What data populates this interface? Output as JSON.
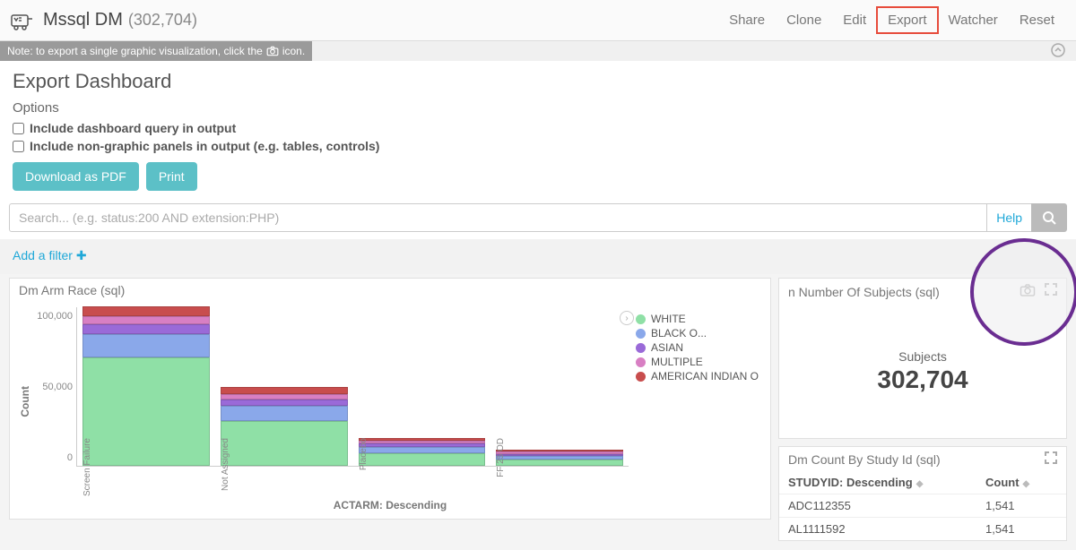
{
  "header": {
    "title": "Mssql DM",
    "count": "(302,704)",
    "nav": [
      "Share",
      "Clone",
      "Edit",
      "Export",
      "Watcher",
      "Reset"
    ],
    "highlighted": "Export"
  },
  "info_note": {
    "prefix": "Note: to export a single graphic visualization, click the",
    "suffix": "icon."
  },
  "export": {
    "title": "Export Dashboard",
    "options_label": "Options",
    "opt1": "Include dashboard query in output",
    "opt2": "Include non-graphic panels in output (e.g. tables, controls)",
    "btn_pdf": "Download as PDF",
    "btn_print": "Print"
  },
  "search": {
    "placeholder": "Search... (e.g. status:200 AND extension:PHP)",
    "help": "Help"
  },
  "filter": {
    "add_label": "Add a filter"
  },
  "panel_chart": {
    "title": "Dm Arm Race (sql)",
    "ylabel": "Count",
    "xlabel": "ACTARM: Descending",
    "yticks": [
      "100,000",
      "50,000",
      "0"
    ]
  },
  "panel_subjects": {
    "title": "n Number Of Subjects (sql)",
    "label": "Subjects",
    "value": "302,704"
  },
  "panel_table": {
    "title": "Dm Count By Study Id (sql)",
    "col1": "STUDYID: Descending",
    "col2": "Count",
    "rows": [
      {
        "study": "ADC112355",
        "count": "1,541"
      },
      {
        "study": "AL1111592",
        "count": "1,541"
      }
    ]
  },
  "chart_data": {
    "type": "bar",
    "stacked": true,
    "categories": [
      "Screen Failure",
      "Not Assigned",
      "Placebo",
      "FF 25 OD"
    ],
    "series": [
      {
        "name": "WHITE",
        "color": "#8fe0a6",
        "values": [
          85000,
          35000,
          10000,
          5000
        ]
      },
      {
        "name": "BLACK O...",
        "color": "#8aa8ea",
        "values": [
          18000,
          12000,
          5000,
          3000
        ]
      },
      {
        "name": "ASIAN",
        "color": "#9a6ad8",
        "values": [
          8000,
          5000,
          2500,
          1500
        ]
      },
      {
        "name": "MULTIPLE",
        "color": "#d87fc3",
        "values": [
          6000,
          4000,
          2000,
          1500
        ]
      },
      {
        "name": "AMERICAN INDIAN O...",
        "color": "#c84d4d",
        "values": [
          8000,
          6000,
          2500,
          2000
        ]
      }
    ],
    "ylabel": "Count",
    "xlabel": "ACTARM: Descending",
    "ylim": [
      0,
      125000
    ]
  }
}
